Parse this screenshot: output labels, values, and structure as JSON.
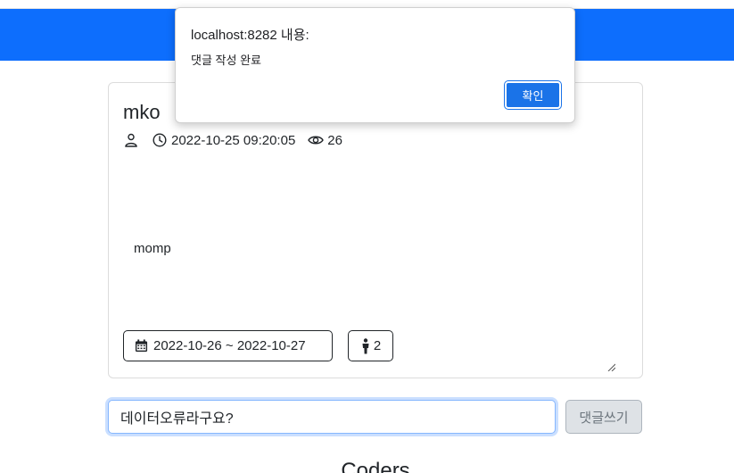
{
  "post": {
    "title": "mko",
    "created_at": "2022-10-25 09:20:05",
    "views": "26",
    "content": "momp",
    "date_range": "2022-10-26 ~ 2022-10-27",
    "people": "2"
  },
  "comment": {
    "input_value": "데이터오류라구요?",
    "submit_label": "댓글쓰기"
  },
  "section": {
    "title": "Coders"
  },
  "dialog": {
    "origin": "localhost:8282 내용:",
    "message": "댓글 작성 완료",
    "ok_label": "확인"
  },
  "colors": {
    "navbar": "#0d6efd",
    "dialog_button": "#1a73e8"
  },
  "icons": {
    "author": "person-icon",
    "time": "clock-icon",
    "views": "eye-icon",
    "date": "calendar-icon",
    "people": "person-standing-icon"
  }
}
